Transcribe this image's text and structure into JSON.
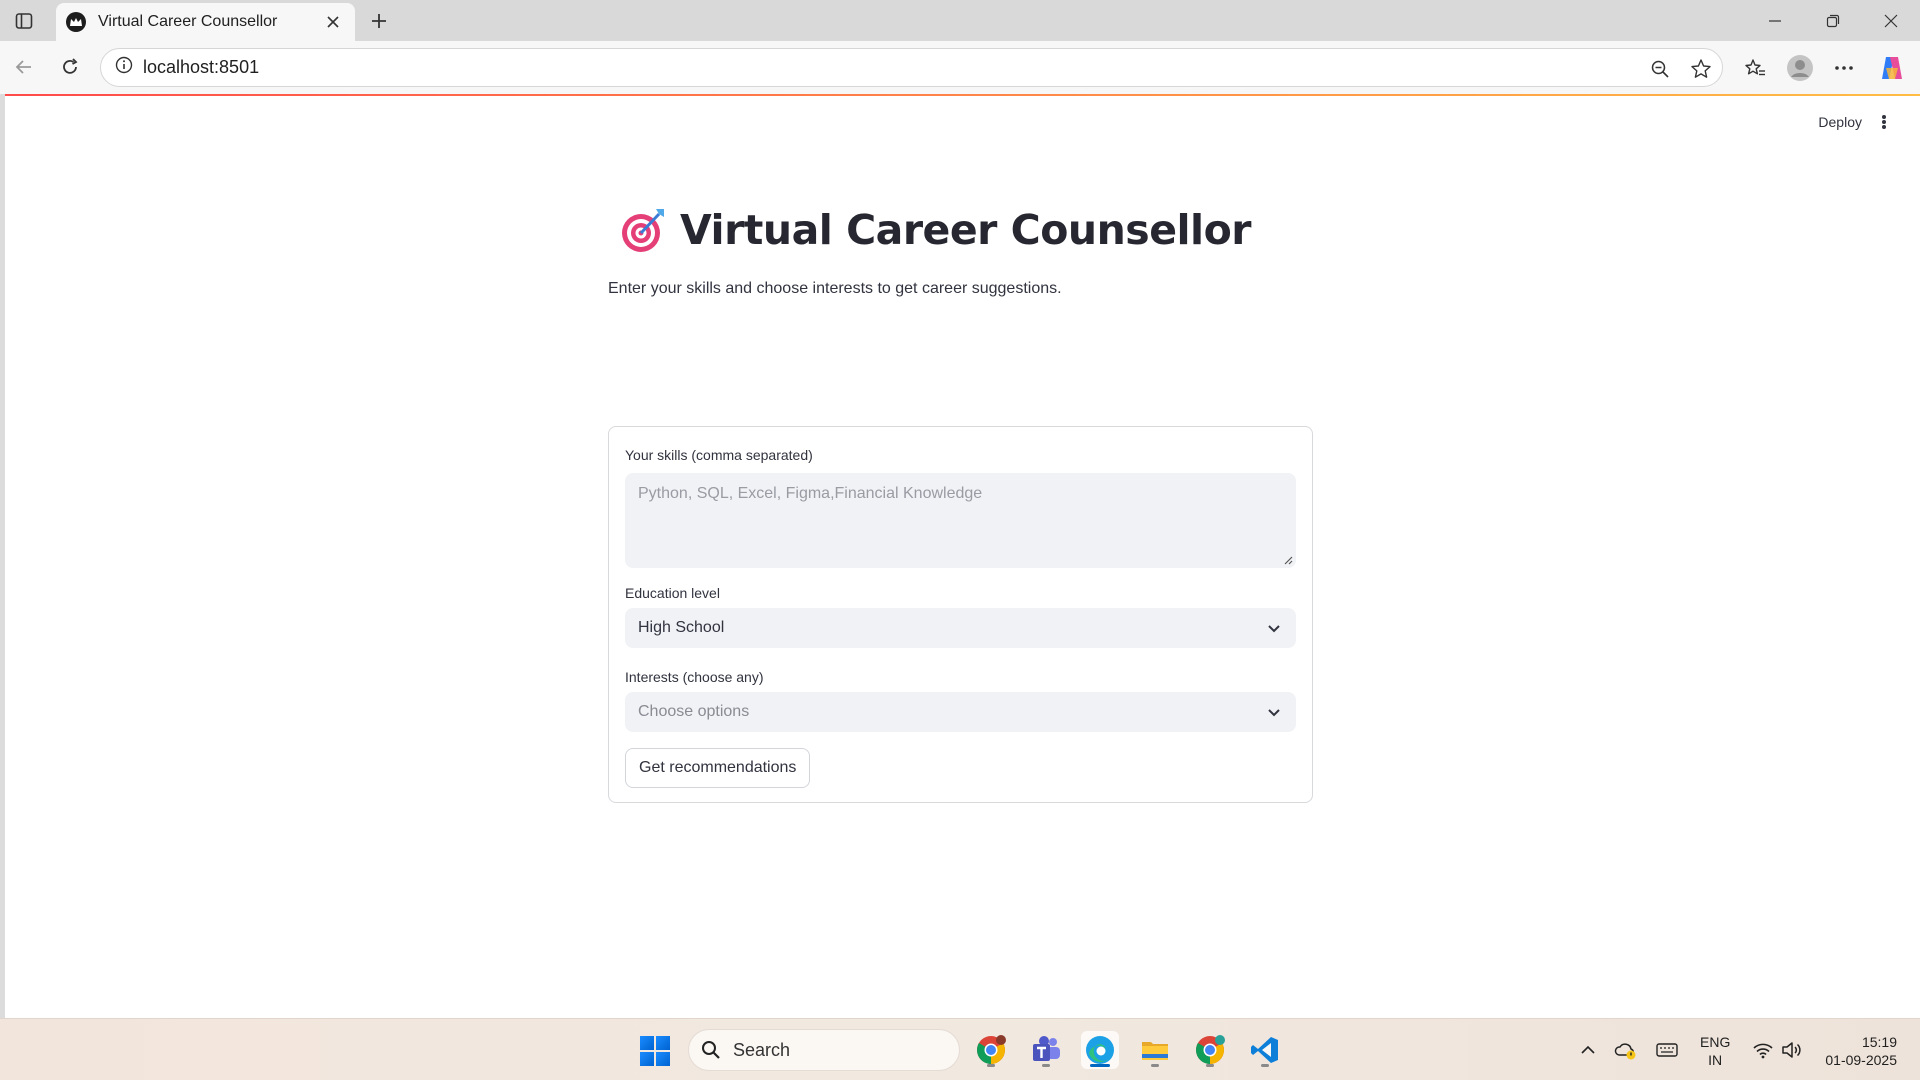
{
  "browser": {
    "tab_title": "Virtual Career Counsellor",
    "url": "localhost:8501"
  },
  "app": {
    "deploy_label": "Deploy",
    "title": "Virtual Career Counsellor",
    "subtitle": "Enter your skills and choose interests to get career suggestions.",
    "form": {
      "skills_label": "Your skills (comma separated)",
      "skills_placeholder": "Python, SQL, Excel, Figma,Financial Knowledge",
      "education_label": "Education level",
      "education_value": "High School",
      "interests_label": "Interests (choose any)",
      "interests_placeholder": "Choose options",
      "submit_label": "Get recommendations"
    },
    "colors": {
      "accent_gradient_start": "#ff4b4b",
      "accent_gradient_end": "#ffbd45",
      "input_bg": "#f0f2f6"
    }
  },
  "taskbar": {
    "search_placeholder": "Search",
    "apps": [
      "chrome-icon",
      "teams-icon",
      "edge-icon",
      "file-explorer-icon",
      "chrome-profile-icon",
      "vscode-icon"
    ],
    "lang_line1": "ENG",
    "lang_line2": "IN",
    "time": "15:19",
    "date": "01-09-2025"
  }
}
